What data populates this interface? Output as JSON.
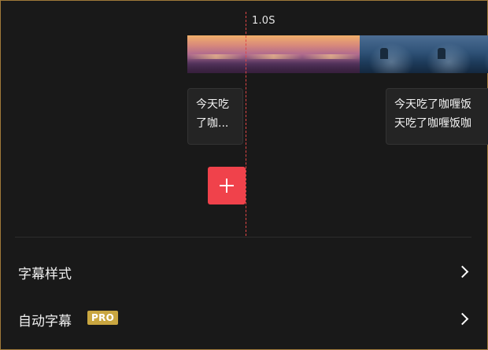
{
  "timeline": {
    "time_marker": "1.0S",
    "thumbnails": [
      "sunset",
      "sunset",
      "sunset",
      "sea",
      "sea",
      "sea"
    ],
    "captions": [
      {
        "line1": "今天吃",
        "line2": "了咖..."
      },
      {
        "line1": "今天吃了咖喱饭",
        "line2": "天吃了咖喱饭咖"
      }
    ],
    "add_button_icon": "plus-icon"
  },
  "menu": {
    "items": [
      {
        "label": "字幕样式",
        "icon": "chevron-right-icon"
      },
      {
        "label": "自动字幕",
        "badge": "PRO",
        "icon": "chevron-right-icon"
      }
    ]
  },
  "colors": {
    "background": "#191919",
    "accent_red": "#f0424b",
    "playhead": "#e04646",
    "pro_badge": "#c9a640"
  }
}
